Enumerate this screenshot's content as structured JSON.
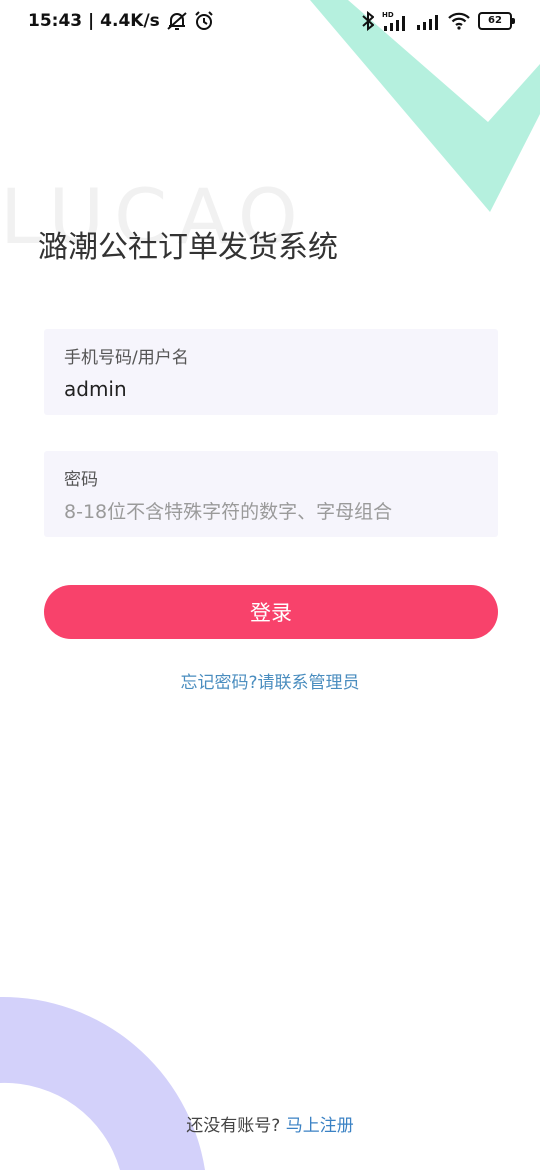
{
  "status_bar": {
    "time_speed": "15:43 | 4.4K/s",
    "network_hd_label": "HD",
    "battery_level": "62",
    "icons": [
      "muted-bell-icon",
      "alarm-clock-icon",
      "bluetooth-icon",
      "signal-hd-icon",
      "signal-icon",
      "wifi-icon",
      "battery-icon"
    ]
  },
  "background": {
    "watermark_text": "LUCAO",
    "check_color": "#b5f0de",
    "arc_color": "#d3d1fa"
  },
  "app": {
    "title": "潞潮公社订单发货系统"
  },
  "form": {
    "username": {
      "label": "手机号码/用户名",
      "value": "admin"
    },
    "password": {
      "label": "密码",
      "placeholder": "8-18位不含特殊字符的数字、字母组合",
      "value": ""
    },
    "login_label": "登录",
    "forgot_text": "忘记密码?请联系管理员"
  },
  "footer": {
    "prompt": "还没有账号?",
    "register_label": "马上注册"
  },
  "colors": {
    "accent": "#f8426b",
    "link": "#4a8dbf",
    "field_bg": "#f6f5fc"
  }
}
